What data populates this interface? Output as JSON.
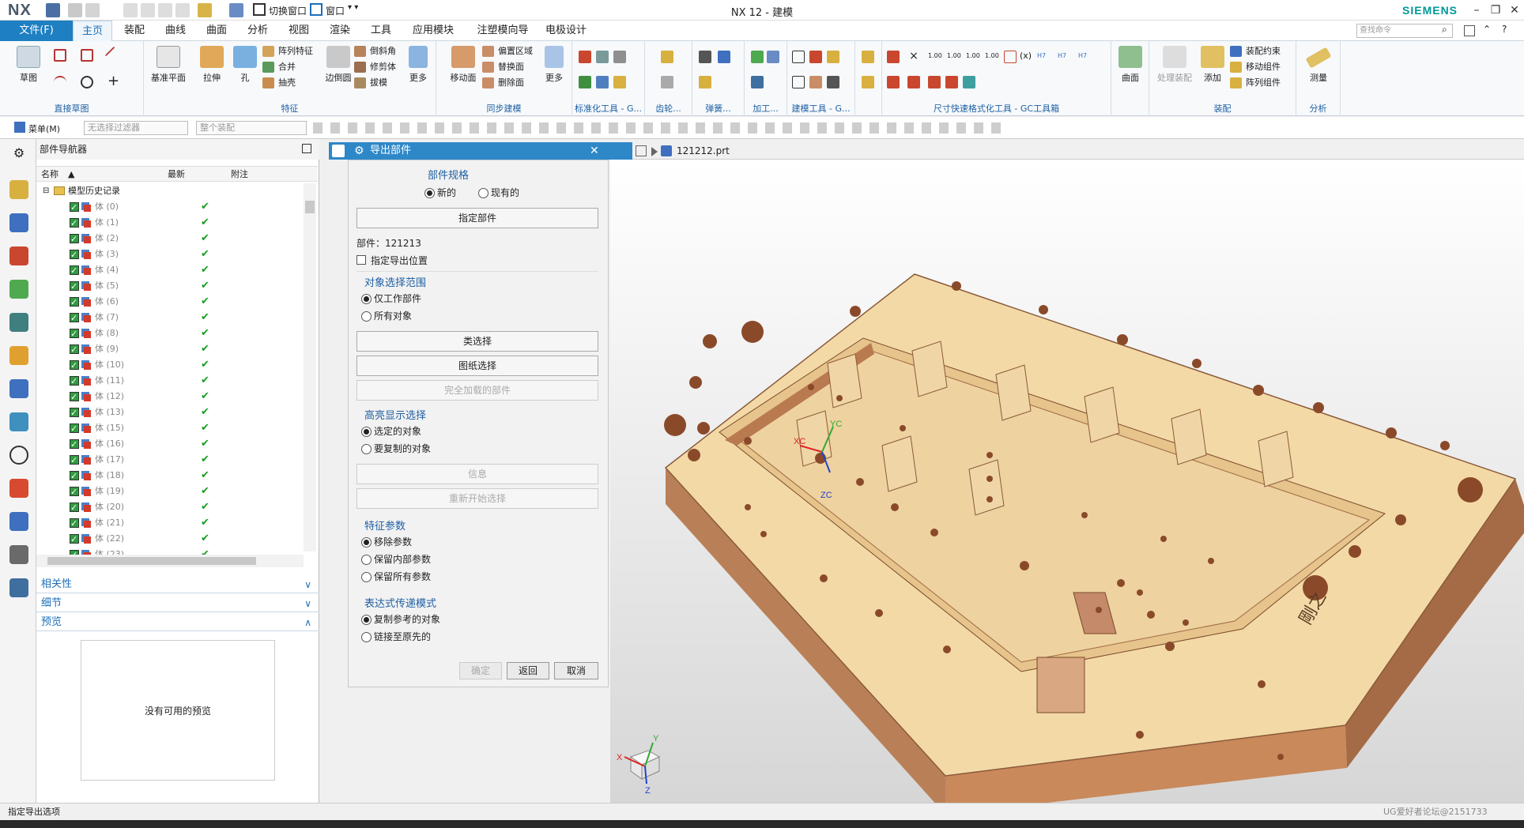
{
  "app": {
    "logo": "NX",
    "title": "NX 12 - 建模",
    "brand": "SIEMENS",
    "quick_access": {
      "switch_window": "切换窗口",
      "window": "窗口"
    }
  },
  "menu_tabs": [
    {
      "label": "文件(F)"
    },
    {
      "label": "主页"
    },
    {
      "label": "装配"
    },
    {
      "label": "曲线"
    },
    {
      "label": "曲面"
    },
    {
      "label": "分析"
    },
    {
      "label": "视图"
    },
    {
      "label": "渲染"
    },
    {
      "label": "工具"
    },
    {
      "label": "应用模块"
    },
    {
      "label": "注塑模向导"
    },
    {
      "label": "电极设计"
    }
  ],
  "command_search": {
    "placeholder": "查找命令"
  },
  "ribbon": {
    "groups": {
      "direct_sketch": "直接草图",
      "feature": "特征",
      "sync_modeling": "同步建模",
      "standard_tools": "标准化工具 - G...",
      "gear": "齿轮...",
      "spring": "弹簧...",
      "machining": "加工...",
      "modeling_tools": "建模工具 - G...",
      "dimension_tools": "尺寸快速格式化工具 - GC工具箱",
      "assembly": "装配",
      "analysis": "分析"
    },
    "buttons": {
      "sketch": "草图",
      "datum_plane": "基准平面",
      "extrude": "拉伸",
      "hole": "孔",
      "pattern_feature": "阵列特征",
      "unite": "合并",
      "shell": "抽壳",
      "edge_blend": "边倒圆",
      "chamfer": "倒斜角",
      "trim_body": "修剪体",
      "draft": "拔模",
      "more1": "更多",
      "move_face": "移动面",
      "offset_region": "偏置区域",
      "replace_face": "替换面",
      "delete_face": "删除面",
      "more2": "更多",
      "surface": "曲面",
      "process_assembly": "处理装配",
      "add": "添加",
      "assembly_constraint": "装配约束",
      "move_component": "移动组件",
      "pattern_component": "阵列组件",
      "measure": "测量"
    },
    "dim_labels": [
      "1.00",
      "1.00",
      "1.00",
      "1.00",
      "H7",
      "H7",
      "H7"
    ]
  },
  "toolbar2": {
    "menu": "菜单(M)",
    "filter": "无选择过滤器",
    "scope": "整个装配"
  },
  "navigator": {
    "title": "部件导航器",
    "columns": {
      "name": "名称",
      "latest": "最新",
      "note": "附注"
    },
    "root": "模型历史记录",
    "rows": [
      {
        "name": "体 (0)",
        "latest": "✔"
      },
      {
        "name": "体 (1)",
        "latest": "✔"
      },
      {
        "name": "体 (2)",
        "latest": "✔"
      },
      {
        "name": "体 (3)",
        "latest": "✔"
      },
      {
        "name": "体 (4)",
        "latest": "✔"
      },
      {
        "name": "体 (5)",
        "latest": "✔"
      },
      {
        "name": "体 (6)",
        "latest": "✔"
      },
      {
        "name": "体 (7)",
        "latest": "✔"
      },
      {
        "name": "体 (8)",
        "latest": "✔"
      },
      {
        "name": "体 (9)",
        "latest": "✔"
      },
      {
        "name": "体 (10)",
        "latest": "✔"
      },
      {
        "name": "体 (11)",
        "latest": "✔"
      },
      {
        "name": "体 (12)",
        "latest": "✔"
      },
      {
        "name": "体 (13)",
        "latest": "✔"
      },
      {
        "name": "体 (15)",
        "latest": "✔"
      },
      {
        "name": "体 (16)",
        "latest": "✔"
      },
      {
        "name": "体 (17)",
        "latest": "✔"
      },
      {
        "name": "体 (18)",
        "latest": "✔"
      },
      {
        "name": "体 (19)",
        "latest": "✔"
      },
      {
        "name": "体 (20)",
        "latest": "✔"
      },
      {
        "name": "体 (21)",
        "latest": "✔"
      },
      {
        "name": "体 (22)",
        "latest": "✔"
      },
      {
        "name": "体 (23)",
        "latest": "✔"
      }
    ],
    "sections": {
      "dependencies": "相关性",
      "details": "细节",
      "preview": "预览"
    },
    "preview_empty": "没有可用的预览"
  },
  "dialog": {
    "title": "导出部件",
    "part_spec": {
      "label": "部件规格",
      "new": "新的",
      "existing": "现有的"
    },
    "specify_part": "指定部件",
    "part_label": "部件：",
    "part_value": "121213",
    "specify_export_location": "指定导出位置",
    "object_scope": {
      "label": "对象选择范围",
      "work_part_only": "仅工作部件",
      "all_objects": "所有对象"
    },
    "class_selection": "类选择",
    "drawing_selection": "图纸选择",
    "fully_loaded": "完全加载的部件",
    "highlight": {
      "label": "高亮显示选择",
      "selected": "选定的对象",
      "to_copy": "要复制的对象"
    },
    "info": "信息",
    "restart_selection": "重新开始选择",
    "feature_params": {
      "label": "特征参数",
      "remove": "移除参数",
      "keep_internal": "保留内部参数",
      "keep_all": "保留所有参数"
    },
    "expression_mode": {
      "label": "表达式传递模式",
      "copy_referenced": "复制参考的对象",
      "link_original": "链接至原先的"
    },
    "ok": "确定",
    "back": "返回",
    "cancel": "取消"
  },
  "graphics": {
    "tab": "121212.prt",
    "axis_labels": {
      "xc": "XC",
      "yc": "YC",
      "zc": "ZC"
    },
    "triad": {
      "x": "X",
      "y": "Y",
      "z": "Z"
    },
    "engraving": "剛之"
  },
  "status": {
    "message": "指定导出选项",
    "watermark": "UG爱好者论坛@2151733"
  },
  "colors": {
    "accent": "#1e7fc3",
    "dialog_title": "#2e88c8",
    "part_top": "#f3d9a6",
    "part_side": "#c68a5e",
    "check_green": "#1a9c22"
  }
}
